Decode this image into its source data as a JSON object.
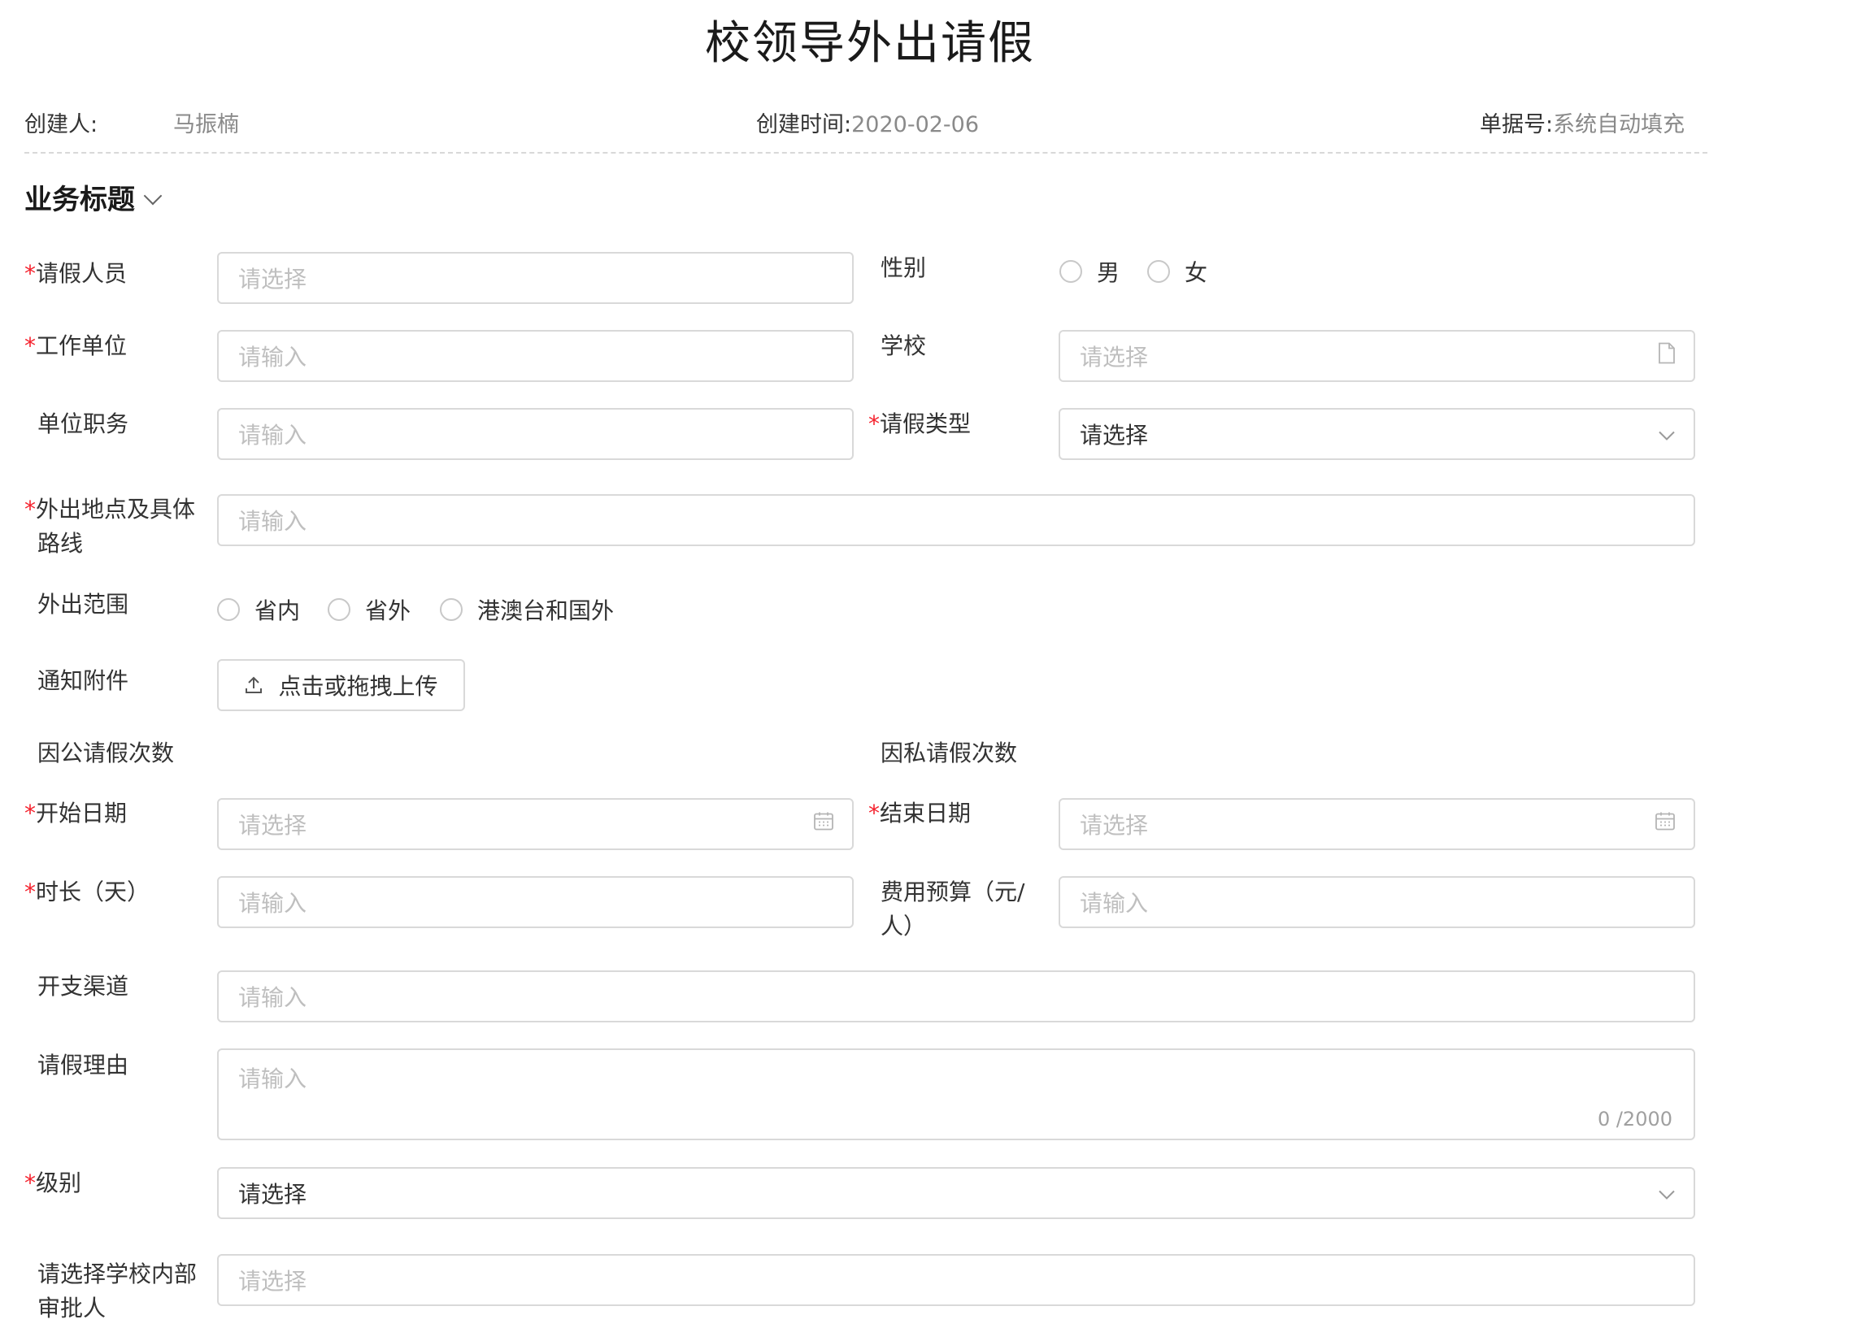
{
  "page": {
    "title": "校领导外出请假"
  },
  "meta": {
    "creator_label": "创建人:",
    "creator_value": "马振楠",
    "created_time_label": "创建时间:",
    "created_time_value": "2020-02-06",
    "doc_no_label": "单据号:",
    "doc_no_value": "系统自动填充"
  },
  "section": {
    "title": "业务标题"
  },
  "fields": {
    "leave_person": {
      "label": "请假人员",
      "required": "*",
      "placeholder": "请选择"
    },
    "gender": {
      "label": "性别",
      "options": [
        "男",
        "女"
      ]
    },
    "work_unit": {
      "label": "工作单位",
      "required": "*",
      "placeholder": "请输入"
    },
    "school": {
      "label": "学校",
      "placeholder": "请选择"
    },
    "unit_position": {
      "label": "单位职务",
      "placeholder": "请输入"
    },
    "leave_type": {
      "label": "请假类型",
      "required": "*",
      "value": "请选择"
    },
    "destination": {
      "label_line1": "外出地点及具体",
      "label_line2": "路线",
      "required": "*",
      "placeholder": "请输入"
    },
    "scope": {
      "label": "外出范围",
      "options": [
        "省内",
        "省外",
        "港澳台和国外"
      ]
    },
    "attachment": {
      "label": "通知附件",
      "button": "点击或拖拽上传"
    },
    "official_count": {
      "label": "因公请假次数"
    },
    "private_count": {
      "label": "因私请假次数"
    },
    "start_date": {
      "label": "开始日期",
      "required": "*",
      "placeholder": "请选择"
    },
    "end_date": {
      "label": "结束日期",
      "required": "*",
      "placeholder": "请选择"
    },
    "duration": {
      "label": "时长（天）",
      "required": "*",
      "placeholder": "请输入"
    },
    "budget": {
      "label_line1": "费用预算（元/",
      "label_line2": "人）",
      "placeholder": "请输入"
    },
    "expense_channel": {
      "label": "开支渠道",
      "placeholder": "请输入"
    },
    "reason": {
      "label": "请假理由",
      "placeholder": "请输入",
      "counter": "0 /2000"
    },
    "level": {
      "label": "级别",
      "required": "*",
      "value": "请选择"
    },
    "approver": {
      "label_line1": "请选择学校内部",
      "label_line2": "审批人",
      "placeholder": "请选择"
    }
  },
  "icons": {
    "file": "file-icon",
    "chevron": "chevron-down-icon",
    "calendar": "calendar-icon",
    "upload": "upload-icon"
  }
}
